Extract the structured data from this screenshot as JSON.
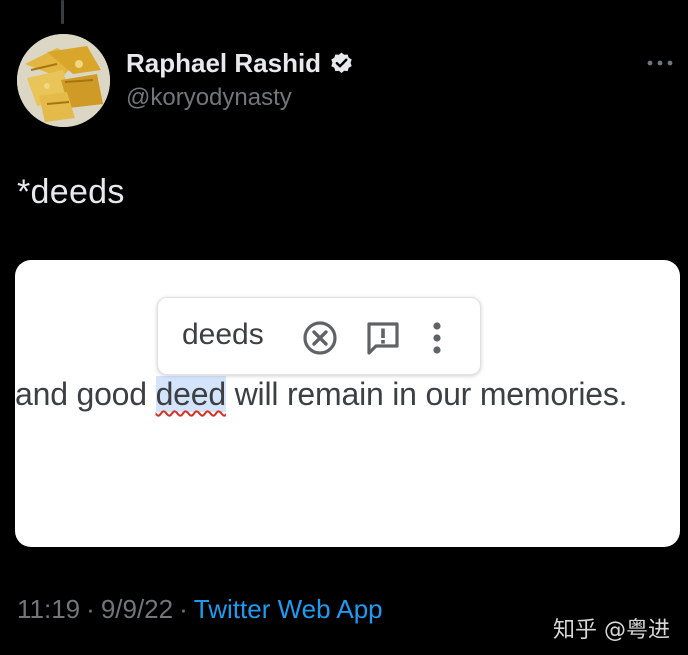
{
  "tweet": {
    "author": {
      "name": "Raphael Rashid",
      "handle": "@koryodynasty",
      "verified": true
    },
    "text": "*deeds",
    "media": {
      "suggestion": {
        "word": "deeds",
        "actions": [
          "dismiss-icon",
          "feedback-icon",
          "more-vert-icon"
        ]
      },
      "sentence": {
        "before": "and good ",
        "misspelled": "deed",
        "after": " will remain in our memories."
      }
    },
    "footer": {
      "time": "11:19",
      "date": "9/9/22",
      "separator": "·",
      "source": "Twitter Web App"
    }
  },
  "watermark": "知乎 @粤进",
  "colors": {
    "background": "#000000",
    "primary_text": "#e7e9ea",
    "secondary_text": "#71767b",
    "link": "#1d9bf0",
    "misspell_underline": "#d93025"
  }
}
